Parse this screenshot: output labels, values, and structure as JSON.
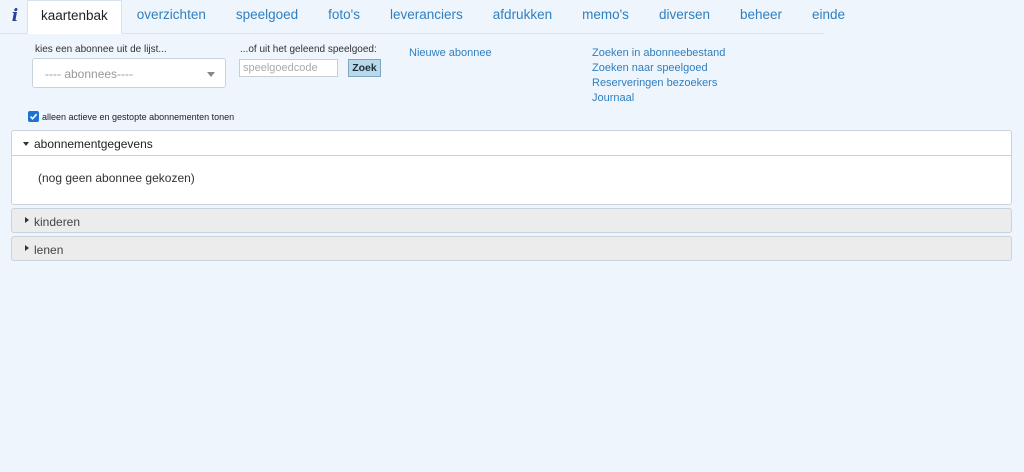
{
  "nav": {
    "info_icon": "info-icon",
    "tabs": [
      {
        "label": "kaartenbak",
        "active": true
      },
      {
        "label": "overzichten"
      },
      {
        "label": "speelgoed"
      },
      {
        "label": "foto's"
      },
      {
        "label": "leveranciers"
      },
      {
        "label": "afdrukken"
      },
      {
        "label": "memo's"
      },
      {
        "label": "diversen"
      },
      {
        "label": "beheer"
      },
      {
        "label": "einde"
      }
    ]
  },
  "search": {
    "subscriber_label": "kies een abonnee uit de lijst...",
    "subscriber_select_value": "---- abonnees----",
    "toy_label": "...of uit het geleend speelgoed:",
    "toy_placeholder": "speelgoedcode",
    "search_button": "Zoek",
    "new_subscriber_link": "Nieuwe abonnee"
  },
  "links": [
    "Zoeken in abonneebestand",
    "Zoeken naar speelgoed",
    "Reserveringen bezoekers",
    "Journaal"
  ],
  "filter": {
    "checked": true,
    "label": "alleen actieve en gestopte abonnementen tonen"
  },
  "sections": {
    "subscription": {
      "title": "abonnementgegevens",
      "body": "(nog geen abonnee gekozen)"
    },
    "children": {
      "title": "kinderen"
    },
    "loans": {
      "title": "lenen"
    }
  },
  "colors": {
    "background": "#eef5fc",
    "link": "#2f7fc0",
    "checkbox": "#1f73d0",
    "button": "#b9d8ea"
  }
}
